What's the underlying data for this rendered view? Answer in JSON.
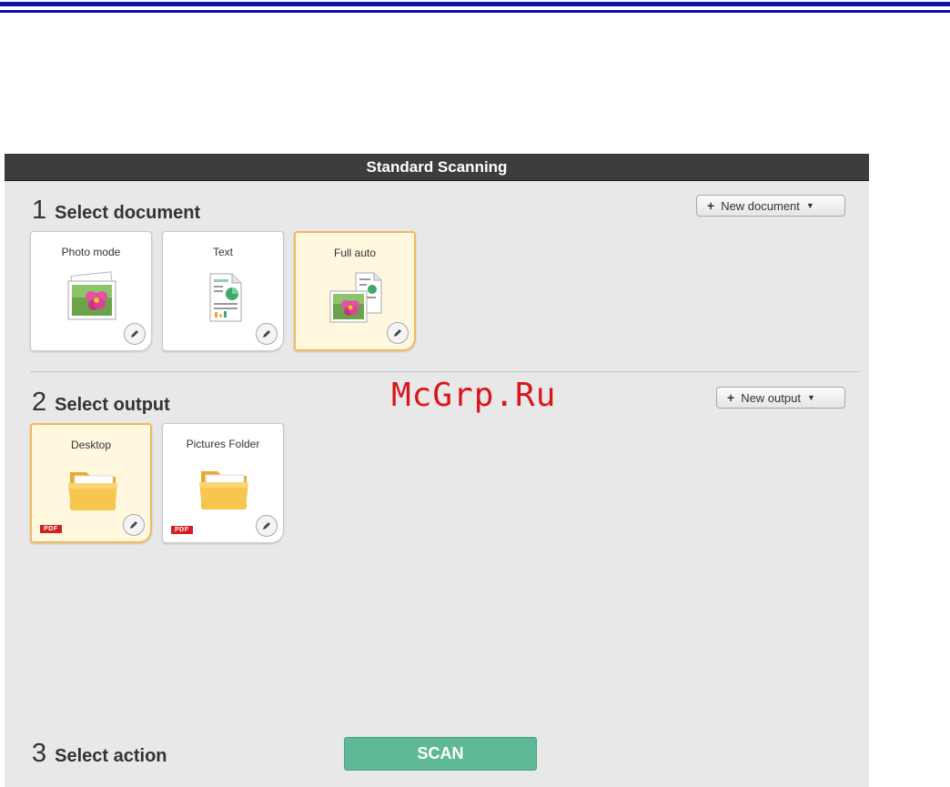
{
  "watermark": "McGrp.Ru",
  "window": {
    "title": "Standard Scanning"
  },
  "section1": {
    "number": "1",
    "title": "Select document",
    "new_button": "New document",
    "tiles": [
      {
        "label": "Photo mode",
        "icon": "photo-icon",
        "selected": false
      },
      {
        "label": "Text",
        "icon": "text-document-icon",
        "selected": false
      },
      {
        "label": "Full auto",
        "icon": "full-auto-icon",
        "selected": true
      }
    ]
  },
  "section2": {
    "number": "2",
    "title": "Select output",
    "new_button": "New output",
    "tiles": [
      {
        "label": "Desktop",
        "icon": "folder-icon",
        "badge": "PDF",
        "selected": true
      },
      {
        "label": "Pictures Folder",
        "icon": "folder-icon",
        "badge": "PDF",
        "selected": false
      }
    ]
  },
  "section3": {
    "number": "3",
    "title": "Select action",
    "scan_button": "SCAN"
  },
  "colors": {
    "accent_selected": "#f1b95d",
    "scan": "#5fb996",
    "titlebar": "#3d3d3d",
    "rule": "#0a10a8"
  }
}
